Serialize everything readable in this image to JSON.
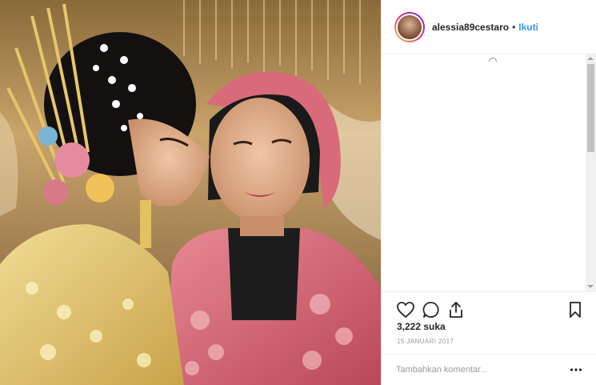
{
  "photo": {
    "alt_subject": "two-women-photo"
  },
  "header": {
    "username": "alessia89cestaro",
    "separator": "•",
    "follow_label": "Ikuti"
  },
  "actions": {
    "like_icon": "heart-icon",
    "comment_icon": "comment-icon",
    "share_icon": "share-icon",
    "save_icon": "bookmark-icon"
  },
  "stats": {
    "likes_text": "3,222 suka",
    "date_text": "15 JANUARI 2017"
  },
  "comment_box": {
    "placeholder": "Tambahkan komentar...",
    "more_icon": "more-options-icon"
  },
  "colors": {
    "link_blue": "#3897f0",
    "text": "#262626",
    "muted": "#999999",
    "border": "#efefef"
  }
}
